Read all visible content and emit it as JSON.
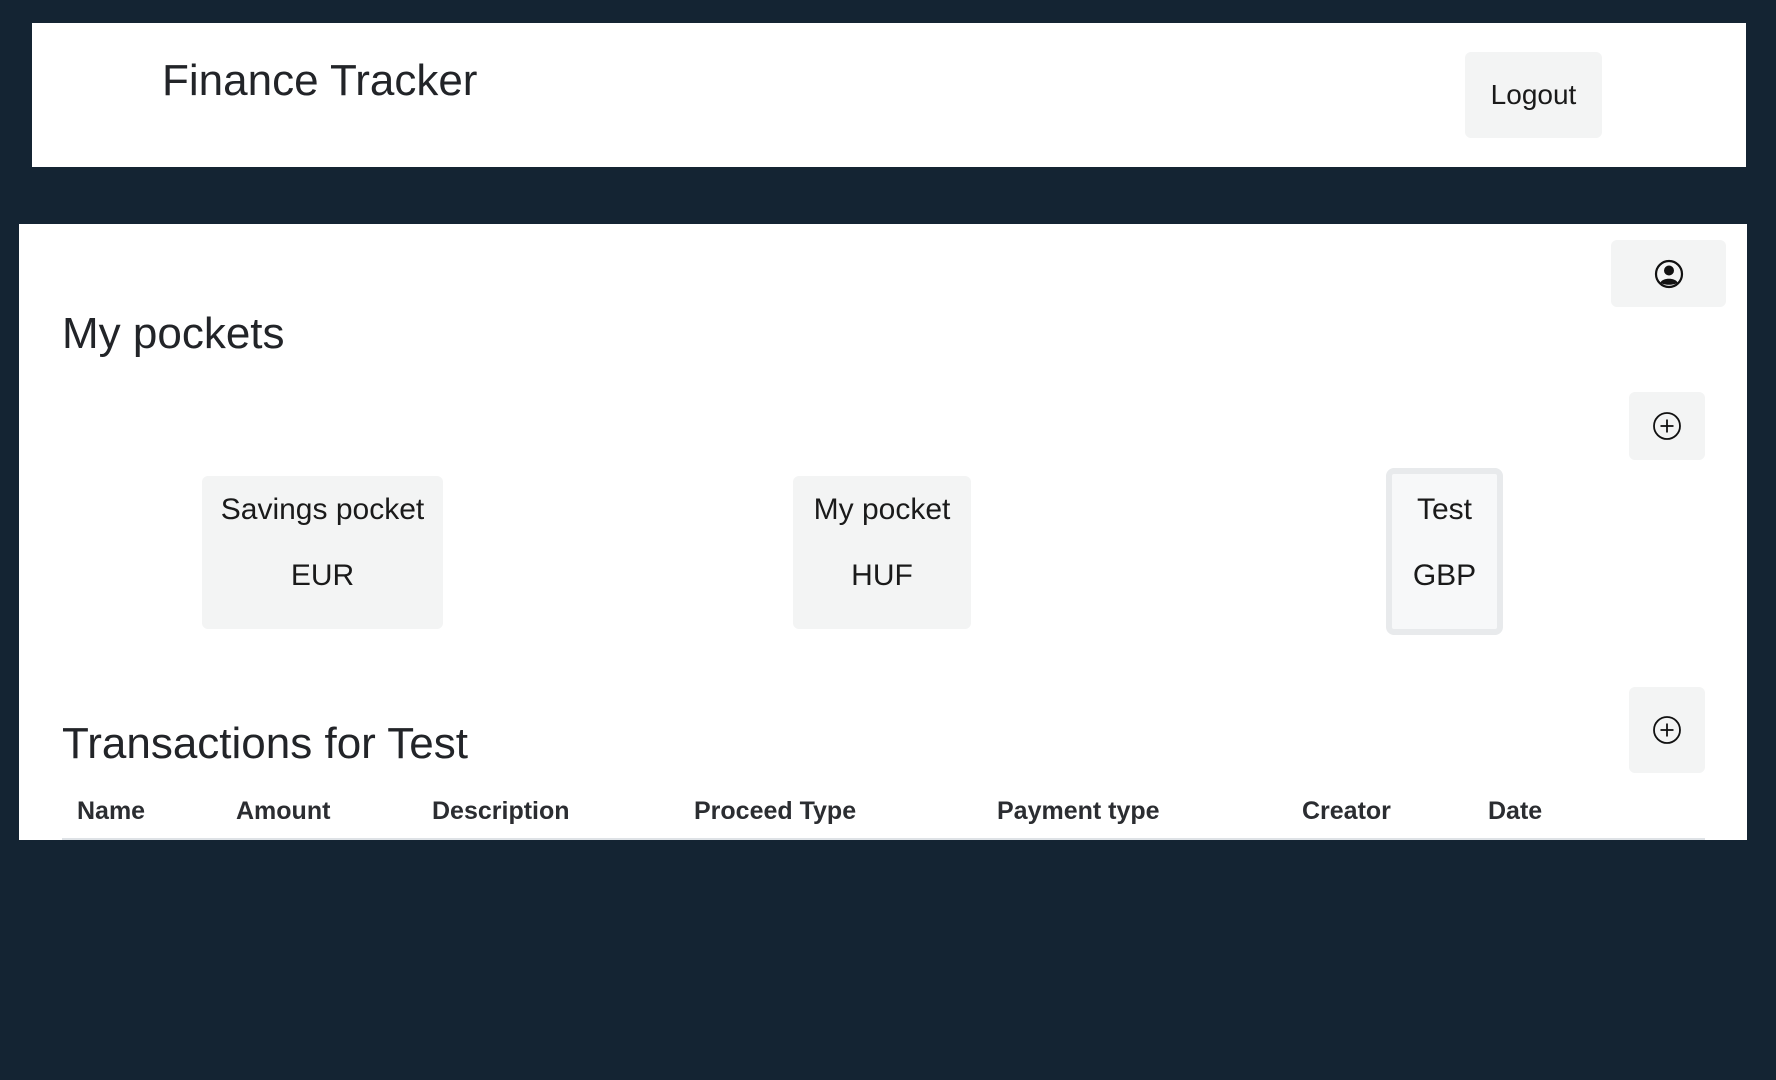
{
  "header": {
    "title": "Finance Tracker",
    "logout_label": "Logout"
  },
  "main": {
    "profile_icon": "user-circle-icon",
    "add_pocket_icon": "plus-circle-icon",
    "pockets_title": "My pockets",
    "pockets": [
      {
        "name": "Savings pocket",
        "currency": "EUR",
        "selected": false
      },
      {
        "name": "My pocket",
        "currency": "HUF",
        "selected": false
      },
      {
        "name": "Test",
        "currency": "GBP",
        "selected": true
      }
    ],
    "transactions_title": "Transactions for Test",
    "add_transaction_icon": "plus-circle-icon",
    "table": {
      "columns": [
        "Name",
        "Amount",
        "Description",
        "Proceed Type",
        "Payment type",
        "Creator",
        "Date"
      ],
      "rows": []
    }
  },
  "colors": {
    "background": "#142433",
    "panel": "#ffffff",
    "button": "#f3f4f4",
    "selected_border": "#e8eaec"
  }
}
